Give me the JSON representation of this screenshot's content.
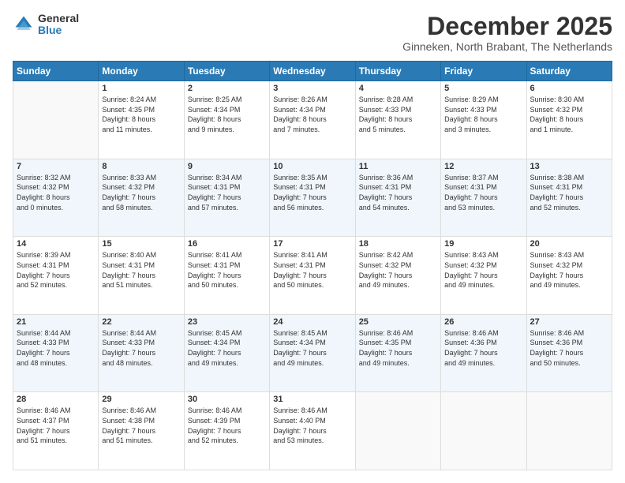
{
  "logo": {
    "general": "General",
    "blue": "Blue"
  },
  "header": {
    "month": "December 2025",
    "location": "Ginneken, North Brabant, The Netherlands"
  },
  "weekdays": [
    "Sunday",
    "Monday",
    "Tuesday",
    "Wednesday",
    "Thursday",
    "Friday",
    "Saturday"
  ],
  "weeks": [
    [
      {
        "day": "",
        "info": ""
      },
      {
        "day": "1",
        "info": "Sunrise: 8:24 AM\nSunset: 4:35 PM\nDaylight: 8 hours\nand 11 minutes."
      },
      {
        "day": "2",
        "info": "Sunrise: 8:25 AM\nSunset: 4:34 PM\nDaylight: 8 hours\nand 9 minutes."
      },
      {
        "day": "3",
        "info": "Sunrise: 8:26 AM\nSunset: 4:34 PM\nDaylight: 8 hours\nand 7 minutes."
      },
      {
        "day": "4",
        "info": "Sunrise: 8:28 AM\nSunset: 4:33 PM\nDaylight: 8 hours\nand 5 minutes."
      },
      {
        "day": "5",
        "info": "Sunrise: 8:29 AM\nSunset: 4:33 PM\nDaylight: 8 hours\nand 3 minutes."
      },
      {
        "day": "6",
        "info": "Sunrise: 8:30 AM\nSunset: 4:32 PM\nDaylight: 8 hours\nand 1 minute."
      }
    ],
    [
      {
        "day": "7",
        "info": "Sunrise: 8:32 AM\nSunset: 4:32 PM\nDaylight: 8 hours\nand 0 minutes."
      },
      {
        "day": "8",
        "info": "Sunrise: 8:33 AM\nSunset: 4:32 PM\nDaylight: 7 hours\nand 58 minutes."
      },
      {
        "day": "9",
        "info": "Sunrise: 8:34 AM\nSunset: 4:31 PM\nDaylight: 7 hours\nand 57 minutes."
      },
      {
        "day": "10",
        "info": "Sunrise: 8:35 AM\nSunset: 4:31 PM\nDaylight: 7 hours\nand 56 minutes."
      },
      {
        "day": "11",
        "info": "Sunrise: 8:36 AM\nSunset: 4:31 PM\nDaylight: 7 hours\nand 54 minutes."
      },
      {
        "day": "12",
        "info": "Sunrise: 8:37 AM\nSunset: 4:31 PM\nDaylight: 7 hours\nand 53 minutes."
      },
      {
        "day": "13",
        "info": "Sunrise: 8:38 AM\nSunset: 4:31 PM\nDaylight: 7 hours\nand 52 minutes."
      }
    ],
    [
      {
        "day": "14",
        "info": "Sunrise: 8:39 AM\nSunset: 4:31 PM\nDaylight: 7 hours\nand 52 minutes."
      },
      {
        "day": "15",
        "info": "Sunrise: 8:40 AM\nSunset: 4:31 PM\nDaylight: 7 hours\nand 51 minutes."
      },
      {
        "day": "16",
        "info": "Sunrise: 8:41 AM\nSunset: 4:31 PM\nDaylight: 7 hours\nand 50 minutes."
      },
      {
        "day": "17",
        "info": "Sunrise: 8:41 AM\nSunset: 4:31 PM\nDaylight: 7 hours\nand 50 minutes."
      },
      {
        "day": "18",
        "info": "Sunrise: 8:42 AM\nSunset: 4:32 PM\nDaylight: 7 hours\nand 49 minutes."
      },
      {
        "day": "19",
        "info": "Sunrise: 8:43 AM\nSunset: 4:32 PM\nDaylight: 7 hours\nand 49 minutes."
      },
      {
        "day": "20",
        "info": "Sunrise: 8:43 AM\nSunset: 4:32 PM\nDaylight: 7 hours\nand 49 minutes."
      }
    ],
    [
      {
        "day": "21",
        "info": "Sunrise: 8:44 AM\nSunset: 4:33 PM\nDaylight: 7 hours\nand 48 minutes."
      },
      {
        "day": "22",
        "info": "Sunrise: 8:44 AM\nSunset: 4:33 PM\nDaylight: 7 hours\nand 48 minutes."
      },
      {
        "day": "23",
        "info": "Sunrise: 8:45 AM\nSunset: 4:34 PM\nDaylight: 7 hours\nand 49 minutes."
      },
      {
        "day": "24",
        "info": "Sunrise: 8:45 AM\nSunset: 4:34 PM\nDaylight: 7 hours\nand 49 minutes."
      },
      {
        "day": "25",
        "info": "Sunrise: 8:46 AM\nSunset: 4:35 PM\nDaylight: 7 hours\nand 49 minutes."
      },
      {
        "day": "26",
        "info": "Sunrise: 8:46 AM\nSunset: 4:36 PM\nDaylight: 7 hours\nand 49 minutes."
      },
      {
        "day": "27",
        "info": "Sunrise: 8:46 AM\nSunset: 4:36 PM\nDaylight: 7 hours\nand 50 minutes."
      }
    ],
    [
      {
        "day": "28",
        "info": "Sunrise: 8:46 AM\nSunset: 4:37 PM\nDaylight: 7 hours\nand 51 minutes."
      },
      {
        "day": "29",
        "info": "Sunrise: 8:46 AM\nSunset: 4:38 PM\nDaylight: 7 hours\nand 51 minutes."
      },
      {
        "day": "30",
        "info": "Sunrise: 8:46 AM\nSunset: 4:39 PM\nDaylight: 7 hours\nand 52 minutes."
      },
      {
        "day": "31",
        "info": "Sunrise: 8:46 AM\nSunset: 4:40 PM\nDaylight: 7 hours\nand 53 minutes."
      },
      {
        "day": "",
        "info": ""
      },
      {
        "day": "",
        "info": ""
      },
      {
        "day": "",
        "info": ""
      }
    ]
  ]
}
